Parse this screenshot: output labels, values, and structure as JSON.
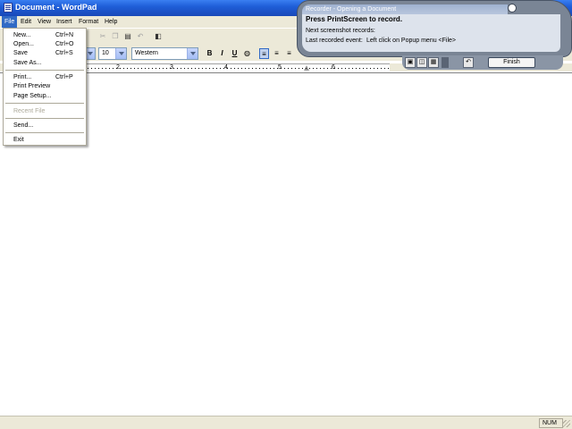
{
  "window": {
    "title": "Document - WordPad"
  },
  "menubar": {
    "items": [
      {
        "label": "File"
      },
      {
        "label": "Edit"
      },
      {
        "label": "View"
      },
      {
        "label": "Insert"
      },
      {
        "label": "Format"
      },
      {
        "label": "Help"
      }
    ],
    "active": "File"
  },
  "file_menu": {
    "items": [
      {
        "label": "New...",
        "shortcut": "Ctrl+N"
      },
      {
        "label": "Open...",
        "shortcut": "Ctrl+O"
      },
      {
        "label": "Save",
        "shortcut": "Ctrl+S"
      },
      {
        "label": "Save As...",
        "shortcut": ""
      },
      {
        "label": "Print...",
        "shortcut": "Ctrl+P"
      },
      {
        "label": "Print Preview",
        "shortcut": ""
      },
      {
        "label": "Page Setup...",
        "shortcut": ""
      },
      {
        "label": "Recent File",
        "shortcut": "",
        "disabled": true
      },
      {
        "label": "Send...",
        "shortcut": ""
      },
      {
        "label": "Exit",
        "shortcut": ""
      }
    ]
  },
  "toolbar": {
    "icons": [
      "cut-icon",
      "copy-icon",
      "paste-icon",
      "undo-icon",
      "date-time-icon"
    ]
  },
  "format_bar": {
    "font_size": "10",
    "script": "Western",
    "bold": "B",
    "italic": "I",
    "underline": "U",
    "icons": [
      "color-icon",
      "align-left-icon",
      "align-center-icon",
      "align-right-icon"
    ]
  },
  "ruler": {
    "numbers": [
      "2",
      "3",
      "4",
      "5",
      "6"
    ]
  },
  "statusbar": {
    "num": "NUM"
  },
  "recorder": {
    "title": "Recorder - Opening a Document",
    "instruction": "Press PrintScreen to record.",
    "next_label": "Next screenshot records:",
    "last_label": "Last recorded event:",
    "last_event": "Left click on Popup menu <File>",
    "finish_label": "Finish",
    "icons": [
      "record-icon",
      "camera-icon",
      "grid-icon",
      "stop-icon",
      "undo-icon"
    ]
  },
  "colors": {
    "titlebar": "#1f5ed8",
    "menu_highlight": "#316ac5",
    "chrome": "#ece9d8",
    "recorder_frame": "#7a8595"
  }
}
